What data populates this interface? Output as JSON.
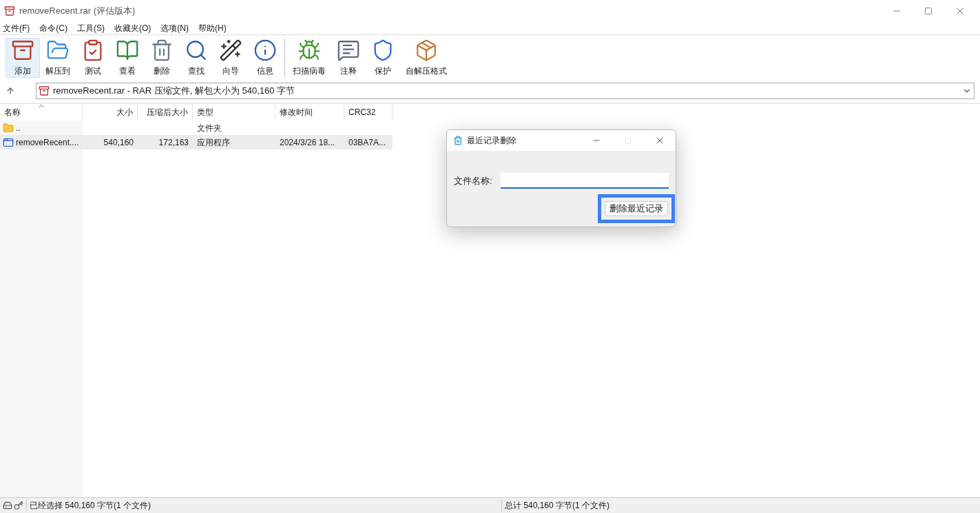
{
  "window": {
    "title": "removeRecent.rar (评估版本)"
  },
  "menu": [
    "文件(F)",
    "命令(C)",
    "工具(S)",
    "收藏夹(O)",
    "选项(N)",
    "帮助(H)"
  ],
  "toolbar": [
    {
      "label": "添加",
      "kind": "add",
      "selected": true,
      "separator_before": false
    },
    {
      "label": "解压到",
      "kind": "extract",
      "selected": false,
      "separator_before": false
    },
    {
      "label": "测试",
      "kind": "test",
      "selected": false,
      "separator_before": false
    },
    {
      "label": "查看",
      "kind": "view",
      "selected": false,
      "separator_before": false
    },
    {
      "label": "删除",
      "kind": "delete",
      "selected": false,
      "separator_before": false
    },
    {
      "label": "查找",
      "kind": "find",
      "selected": false,
      "separator_before": false
    },
    {
      "label": "向导",
      "kind": "wizard",
      "selected": false,
      "separator_before": false
    },
    {
      "label": "信息",
      "kind": "info",
      "selected": false,
      "separator_before": false
    },
    {
      "label": "扫描病毒",
      "kind": "scan",
      "selected": false,
      "separator_before": true
    },
    {
      "label": "注释",
      "kind": "comment",
      "selected": false,
      "separator_before": false
    },
    {
      "label": "保护",
      "kind": "protect",
      "selected": false,
      "separator_before": false
    },
    {
      "label": "自解压格式",
      "kind": "sfx",
      "selected": false,
      "separator_before": false
    }
  ],
  "address": "removeRecent.rar - RAR 压缩文件, 解包大小为 540,160 字节",
  "table": {
    "columns": [
      {
        "label": "名称",
        "sorted": true
      },
      {
        "label": "大小",
        "sorted": false
      },
      {
        "label": "压缩后大小",
        "sorted": false
      },
      {
        "label": "类型",
        "sorted": false
      },
      {
        "label": "修改时间",
        "sorted": false
      },
      {
        "label": "CRC32",
        "sorted": false
      }
    ],
    "rows": [
      {
        "kind": "folder",
        "selected": false,
        "cells": [
          "..",
          "",
          "",
          "文件夹",
          "",
          ""
        ]
      },
      {
        "kind": "exe",
        "selected": true,
        "cells": [
          "removeRecent....",
          "540,160",
          "172,163",
          "应用程序",
          "2024/3/26 18...",
          "03BA7A..."
        ]
      }
    ]
  },
  "dialog": {
    "title": "最近记录删除",
    "field_label": "文件名称:",
    "button": "删除最近记录",
    "button_highlighted": true
  },
  "status_bar": {
    "left": "已经选择 540,160 字节(1 个文件)",
    "right": "总计 540,160 字节(1 个文件)"
  }
}
